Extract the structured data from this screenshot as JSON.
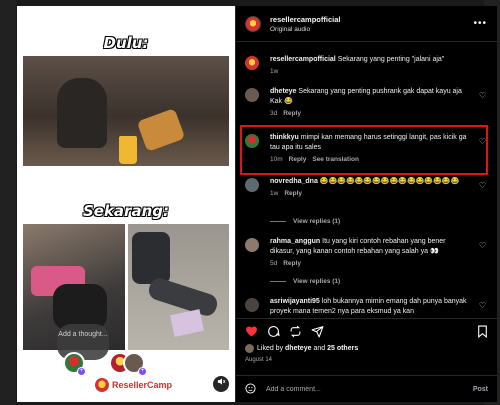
{
  "colors": {
    "highlight": "#e0141f",
    "like_red": "#ff3040",
    "brand": "#d3302f"
  },
  "media": {
    "caption_top": "Dulu:",
    "caption_bottom": "Sekarang:",
    "thought_placeholder": "Add a thought...",
    "brand_name": "ResellerCamp",
    "mute_icon": "speaker-muted-icon"
  },
  "header": {
    "username": "resellercampofficial",
    "subtitle": "Original audio",
    "more_icon": "ellipsis-icon"
  },
  "comments": [
    {
      "user": "resellercampofficial",
      "text": "Sekarang yang penting \"jalani aja\"",
      "time": "1w",
      "likes": "",
      "reply": "",
      "translate": ""
    },
    {
      "user": "dheteye",
      "text": "Sekarang yang penting pushrank gak dapat kayu aja Kak 😂",
      "time": "3d",
      "likes": "",
      "reply": "Reply",
      "translate": ""
    },
    {
      "user": "thinkkyu",
      "text": "mimpi kan memang harus setinggi langit, pas kicik ga tau apa itu sales",
      "time": "10m",
      "likes": "",
      "reply": "Reply",
      "translate": "See translation"
    },
    {
      "user": "novredha_dna",
      "text": "😂😂😂😂😂😂😂😂😂😂😂😂😂😂😂😂",
      "time": "1w",
      "likes": "",
      "reply": "Reply",
      "translate": ""
    },
    {
      "user": "rahma_anggun",
      "text": "Itu yang kiri contoh rebahan yang bener dikasur, yang kanan contoh rebahan yang salah ya 👀",
      "time": "5d",
      "likes": "",
      "reply": "Reply",
      "translate": ""
    },
    {
      "user": "asriwijayanti95",
      "text": "loh bukannya mimin emang dah punya banyak proyek mana temen2 nya para eksmud ya kan",
      "time": "",
      "likes": "",
      "reply": "",
      "translate": ""
    }
  ],
  "view_replies": [
    "View replies (1)",
    "View replies (1)"
  ],
  "actions": {
    "liked_prefix": "Liked by",
    "liked_user": "dheteye",
    "liked_and": "and",
    "liked_others": "25 others",
    "date": "August 14",
    "add_comment_placeholder": "Add a comment...",
    "post_label": "Post"
  }
}
